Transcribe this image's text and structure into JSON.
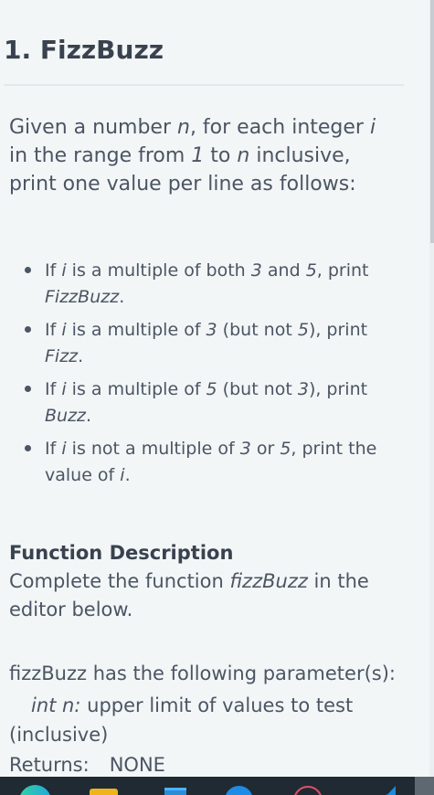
{
  "problem": {
    "title": "1. FizzBuzz",
    "intro": [
      {
        "text": "Given a number "
      },
      {
        "text": "n",
        "italic": true
      },
      {
        "text": ", for each integer "
      },
      {
        "text": "i",
        "italic": true
      },
      {
        "text": " in the range from "
      },
      {
        "text": "1",
        "italic": true
      },
      {
        "text": " to "
      },
      {
        "text": "n",
        "italic": true
      },
      {
        "text": " inclusive, print one value per line as follows:"
      }
    ],
    "rules": [
      [
        {
          "text": "If "
        },
        {
          "text": "i",
          "italic": true
        },
        {
          "text": " is a multiple of both "
        },
        {
          "text": "3",
          "italic": true
        },
        {
          "text": " and "
        },
        {
          "text": "5",
          "italic": true
        },
        {
          "text": ", print "
        },
        {
          "text": "FizzBuzz",
          "italic": true
        },
        {
          "text": "."
        }
      ],
      [
        {
          "text": "If "
        },
        {
          "text": "i",
          "italic": true
        },
        {
          "text": " is a multiple of "
        },
        {
          "text": "3",
          "italic": true
        },
        {
          "text": " (but not "
        },
        {
          "text": "5",
          "italic": true
        },
        {
          "text": "), print "
        },
        {
          "text": "Fizz",
          "italic": true
        },
        {
          "text": "."
        }
      ],
      [
        {
          "text": "If "
        },
        {
          "text": "i",
          "italic": true
        },
        {
          "text": " is a multiple of "
        },
        {
          "text": "5",
          "italic": true
        },
        {
          "text": " (but not "
        },
        {
          "text": "3",
          "italic": true
        },
        {
          "text": "), print "
        },
        {
          "text": "Buzz",
          "italic": true
        },
        {
          "text": "."
        }
      ],
      [
        {
          "text": "If "
        },
        {
          "text": "i",
          "italic": true
        },
        {
          "text": " is not a multiple of "
        },
        {
          "text": "3",
          "italic": true
        },
        {
          "text": " or "
        },
        {
          "text": "5",
          "italic": true
        },
        {
          "text": ", print the value of "
        },
        {
          "text": "i",
          "italic": true
        },
        {
          "text": "."
        }
      ]
    ],
    "function_description": {
      "heading": "Function Description",
      "text": [
        {
          "text": "Complete the function "
        },
        {
          "text": "fizzBuzz",
          "italic": true
        },
        {
          "text": " in the editor below."
        }
      ],
      "params_intro": "fizzBuzz has the following parameter(s):",
      "param": [
        {
          "text": "int n:",
          "italic": true
        },
        {
          "text": "  upper limit of values to test (inclusive)"
        }
      ],
      "returns_label": "Returns:",
      "returns_value": "NONE"
    }
  },
  "taskbar": {
    "icons": [
      "edge-browser-icon",
      "file-explorer-icon",
      "store-icon",
      "blue-app-icon",
      "red-app-icon",
      "vscode-icon"
    ]
  },
  "colors": {
    "background": "#f3f6f7",
    "text": "#39424e",
    "taskbar": "#1f2a33"
  }
}
